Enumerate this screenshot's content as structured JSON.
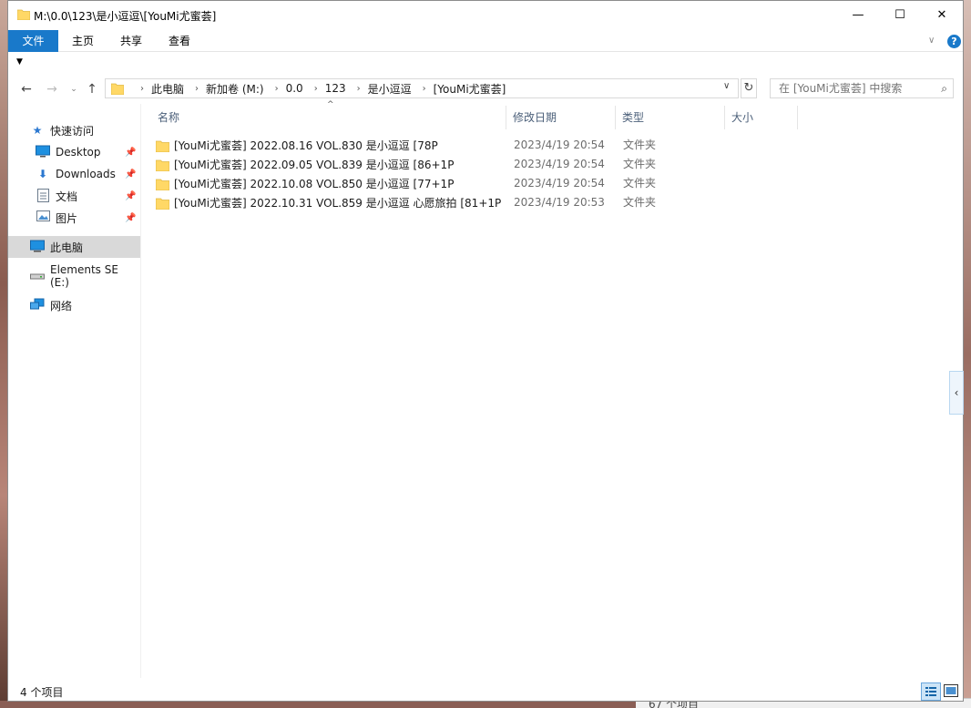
{
  "window": {
    "title": "M:\\0.0\\123\\是小逗逗\\[YouMi尤蜜荟]",
    "min_glyph": "—",
    "max_glyph": "☐",
    "close_glyph": "✕"
  },
  "ribbon": {
    "tabs": [
      "文件",
      "主页",
      "共享",
      "查看"
    ],
    "help_glyph": "?"
  },
  "nav": {
    "back": "←",
    "forward": "→",
    "recent": "⌄",
    "up": "↑",
    "breadcrumbs": [
      "此电脑",
      "新加卷 (M:)",
      "0.0",
      "123",
      "是小逗逗",
      "[YouMi尤蜜荟]"
    ],
    "refresh": "↻"
  },
  "search": {
    "placeholder": "在 [YouMi尤蜜荟] 中搜索"
  },
  "sidebar": {
    "items": [
      {
        "label": "快速访问",
        "icon": "star-icon",
        "pinned": false
      },
      {
        "label": "Desktop",
        "icon": "desktop-icon",
        "pinned": true
      },
      {
        "label": "Downloads",
        "icon": "download-icon",
        "pinned": true
      },
      {
        "label": "文档",
        "icon": "document-icon",
        "pinned": true
      },
      {
        "label": "图片",
        "icon": "picture-icon",
        "pinned": true
      },
      {
        "label": "此电脑",
        "icon": "computer-icon",
        "pinned": false,
        "selected": true
      },
      {
        "label": "Elements SE (E:)",
        "icon": "drive-icon",
        "pinned": false
      },
      {
        "label": "网络",
        "icon": "network-icon",
        "pinned": false
      }
    ]
  },
  "columns": [
    "名称",
    "修改日期",
    "类型",
    "大小"
  ],
  "files": [
    {
      "name": "[YouMi尤蜜荟] 2022.08.16 VOL.830 是小逗逗 [78P",
      "date": "2023/4/19 20:54",
      "type": "文件夹"
    },
    {
      "name": "[YouMi尤蜜荟] 2022.09.05 VOL.839 是小逗逗 [86+1P",
      "date": "2023/4/19 20:54",
      "type": "文件夹"
    },
    {
      "name": "[YouMi尤蜜荟] 2022.10.08 VOL.850 是小逗逗 [77+1P",
      "date": "2023/4/19 20:54",
      "type": "文件夹"
    },
    {
      "name": "[YouMi尤蜜荟] 2022.10.31 VOL.859 是小逗逗 心愿旅拍 [81+1P",
      "date": "2023/4/19 20:53",
      "type": "文件夹"
    }
  ],
  "status": {
    "count": "4 个项目"
  },
  "background": {
    "partial_status": "67 个项目"
  },
  "colors": {
    "accent": "#1979ca",
    "folder": "#ffd866",
    "selected_bg": "#d9d9d9"
  }
}
